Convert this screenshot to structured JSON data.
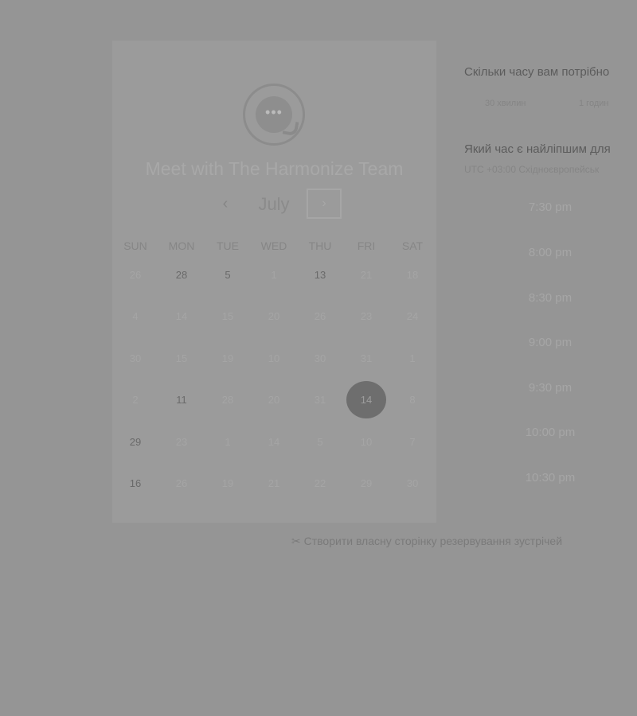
{
  "card": {
    "title": "Meet with The Harmonize Team",
    "month": "July",
    "prev_icon": "‹",
    "next_icon": "›",
    "weekdays": [
      "SUN",
      "MON",
      "TUE",
      "WED",
      "THU",
      "FRI",
      "SAT"
    ],
    "weeks": [
      [
        "26",
        "28",
        "5",
        "1",
        "13",
        "21",
        "18"
      ],
      [
        "4",
        "14",
        "15",
        "20",
        "26",
        "23",
        "24"
      ],
      [
        "30",
        "15",
        "19",
        "10",
        "30",
        "31",
        "1"
      ],
      [
        "2",
        "11",
        "28",
        "20",
        "31",
        "14",
        "8"
      ],
      [
        "29",
        "23",
        "1",
        "14",
        "5",
        "10",
        "7"
      ],
      [
        "16",
        "26",
        "19",
        "21",
        "22",
        "29",
        "30"
      ]
    ],
    "available_days": [
      "28",
      "5",
      "13",
      "11",
      "29",
      "16"
    ],
    "selected_day": "14"
  },
  "right": {
    "duration_question": "Скільки часу вам потрібно",
    "durations": [
      "30 хвилин",
      "1 годин"
    ],
    "time_question": "Який час є найліпшим для",
    "timezone": "UTC +03:00 Східноєвропейськ",
    "slots": [
      "7:30 pm",
      "8:00 pm",
      "8:30 pm",
      "9:00 pm",
      "9:30 pm",
      "10:00 pm",
      "10:30 pm"
    ]
  },
  "footer": {
    "link_icon": "✂",
    "link_label": "Створити власну сторінку резервування зустрічей"
  }
}
